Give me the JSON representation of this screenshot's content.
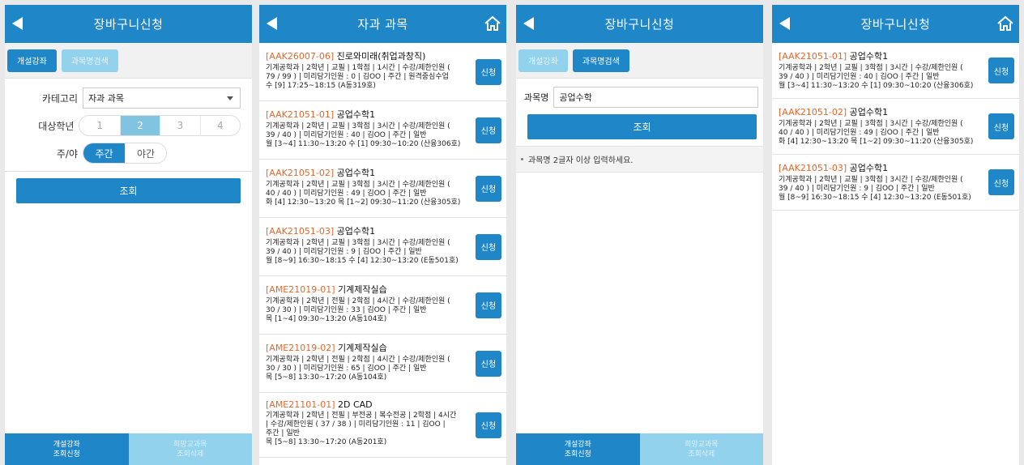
{
  "screen1": {
    "title": "장바구니신청",
    "tabs": [
      "개설강좌",
      "과목명검색"
    ],
    "category_label": "카테고리",
    "category_value": "자과 과목",
    "grade_label": "대상학년",
    "grades": [
      "1",
      "2",
      "3",
      "4"
    ],
    "selected_grade": "2",
    "daynight_label": "주/야",
    "daynight_options": [
      "주간",
      "야간"
    ],
    "query_label": "조회",
    "bottom_nav": [
      {
        "line1": "개설강좌",
        "line2": "조회신청"
      },
      {
        "line1": "희망교과목",
        "line2": "조회삭제"
      }
    ]
  },
  "screen2": {
    "title": "자과 과목",
    "apply_label": "신청",
    "courses": [
      {
        "code": "[AAK26007-06]",
        "name": "진로와미래(취업과창직)",
        "lines": [
          "기계공학과 | 2학년 | 교필 | 1학점 | 1시간 | 수강/제한인원 (",
          "79 / 99 ) | 미리담기인원 : 0 | 김OO | 주간 | 원격중심수업",
          "수 [9] 17:25~18:15 (A동319호)"
        ]
      },
      {
        "code": "[AAK21051-01]",
        "name": "공업수학1",
        "lines": [
          "기계공학과 | 2학년 | 교필 | 3학점 | 3시간 | 수강/제한인원 (",
          "39 / 40 ) | 미리담기인원 : 40 | 김OO | 주간 | 일반",
          "월 [3~4] 11:30~13:20 수 [1] 09:30~10:20 (산융306호)"
        ]
      },
      {
        "code": "[AAK21051-02]",
        "name": "공업수학1",
        "lines": [
          "기계공학과 | 2학년 | 교필 | 3학점 | 3시간 | 수강/제한인원 (",
          "40 / 40 ) | 미리담기인원 : 49 | 김OO | 주간 | 일반",
          "화 [4] 12:30~13:20 목 [1~2] 09:30~11:20 (산융305호)"
        ]
      },
      {
        "code": "[AAK21051-03]",
        "name": "공업수학1",
        "lines": [
          "기계공학과 | 2학년 | 교필 | 3학점 | 3시간 | 수강/제한인원 (",
          "39 / 40 ) | 미리담기인원 : 9 | 김OO | 주간 | 일반",
          "월 [8~9] 16:30~18:15 수 [4] 12:30~13:20 (E동501호)"
        ]
      },
      {
        "code": "[AME21019-01]",
        "name": "기계제작실습",
        "lines": [
          "기계공학과 | 2학년 | 전필 | 2학점 | 4시간 | 수강/제한인원 (",
          "30 / 30 ) | 미리담기인원 : 33 | 김OO | 주간 | 일반",
          "목 [1~4] 09:30~13:20 (A동104호)"
        ]
      },
      {
        "code": "[AME21019-02]",
        "name": "기계제작실습",
        "lines": [
          "기계공학과 | 2학년 | 전필 | 2학점 | 4시간 | 수강/제한인원 (",
          "30 / 30 ) | 미리담기인원 : 65 | 김OO | 주간 | 일반",
          "목 [5~8] 13:30~17:20 (A동104호)"
        ]
      },
      {
        "code": "[AME21101-01]",
        "name": "2D CAD",
        "lines": [
          "기계공학과 | 2학년 | 전필 | 부전공 | 복수전공 | 2학점 | 4시간",
          "| 수강/제한인원 ( 37 / 38 ) | 미리담기인원 : 11 | 김OO |",
          "주간 | 일반",
          "목 [5~8] 13:30~17:20 (A동201호)"
        ]
      }
    ]
  },
  "screen3": {
    "title": "장바구니신청",
    "tabs": [
      "개설강좌",
      "과목명검색"
    ],
    "search_label": "과목명",
    "search_value": "공업수학",
    "query_label": "조회",
    "notice": "과목명 2글자 이상 입력하세요.",
    "bottom_nav": [
      {
        "line1": "개설강좌",
        "line2": "조회신청"
      },
      {
        "line1": "희망교과목",
        "line2": "조회삭제"
      }
    ]
  },
  "screen4": {
    "title": "장바구니신청",
    "apply_label": "신청",
    "courses": [
      {
        "code": "[AAK21051-01]",
        "name": "공업수학1",
        "lines": [
          "기계공학과 | 2학년 | 교필 | 3학점 | 3시간 | 수강/제한인원 (",
          "39 / 40 ) | 미리담기인원 : 40 | 김OO | 주간 | 일반",
          "월 [3~4] 11:30~13:20 수 [1] 09:30~10:20 (산융306호)"
        ]
      },
      {
        "code": "[AAK21051-02]",
        "name": "공업수학1",
        "lines": [
          "기계공학과 | 2학년 | 교필 | 3학점 | 3시간 | 수강/제한인원 (",
          "40 / 40 ) | 미리담기인원 : 49 | 김OO | 주간 | 일반",
          "화 [4] 12:30~13:20 목 [1~2] 09:30~11:20 (산융305호)"
        ]
      },
      {
        "code": "[AAK21051-03]",
        "name": "공업수학1",
        "lines": [
          "기계공학과 | 2학년 | 교필 | 3학점 | 3시간 | 수강/제한인원 (",
          "39 / 40 ) | 미리담기인원 : 9 | 김OO | 주간 | 일반",
          "월 [8~9] 16:30~18:15 수 [4] 12:30~13:20 (E동501호)"
        ]
      }
    ]
  },
  "colors": {
    "header": "#1f86c8",
    "accent_code": "#e8652a",
    "tab_inactive": "#92d2ec"
  },
  "icons": {
    "back": "back-arrow-icon",
    "home": "home-icon"
  }
}
